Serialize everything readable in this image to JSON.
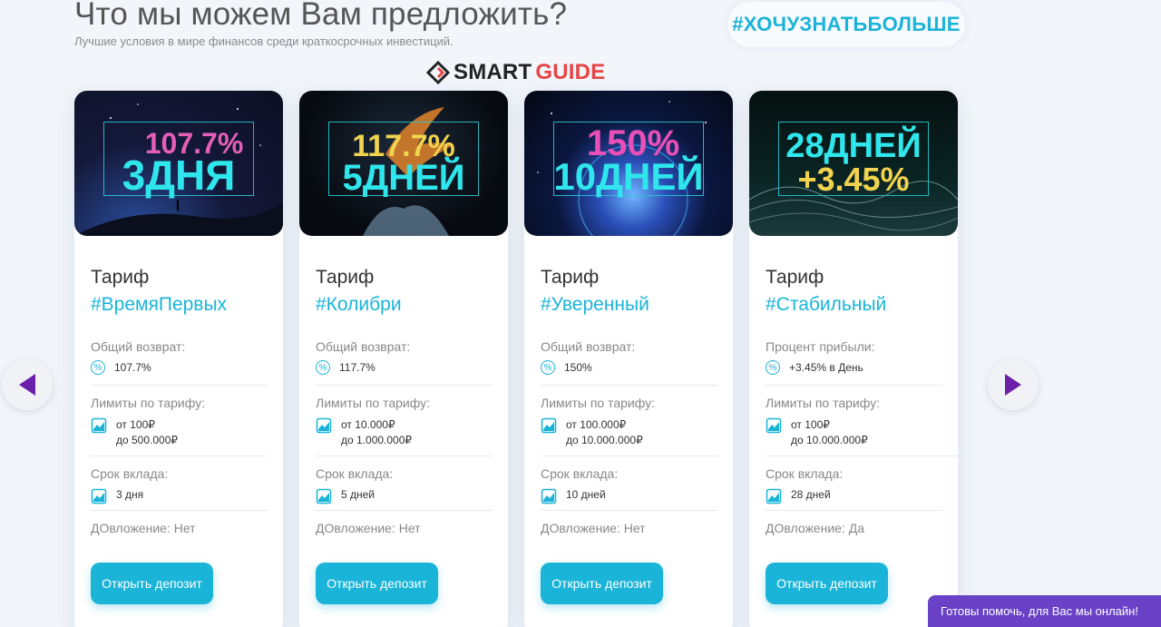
{
  "header": {
    "title": "Что мы можем Вам предложить?",
    "subtitle": "Лучшие условия в мире финансов среди краткосрочных инвестиций.",
    "tag": "#ХОЧУЗНАТЬБОЛЬШЕ"
  },
  "logo": {
    "part1": "SMART",
    "part2": "GUIDE"
  },
  "cards": [
    {
      "img_top": "107.7%",
      "img_bottom": "3ДНЯ",
      "label": "Тариф",
      "name": "#ВремяПервых",
      "return_title": "Общий возврат:",
      "return_value": "107.7%",
      "limits_title": "Лимиты по тарифу:",
      "limit_from": "от 100₽",
      "limit_to": "до 500.000₽",
      "term_title": "Срок вклада:",
      "term_value": "3 дня",
      "reinvest": "ДОвложение: Нет",
      "button": "Открыть депозит"
    },
    {
      "img_top": "117.7%",
      "img_bottom": "5ДНЕЙ",
      "label": "Тариф",
      "name": "#Колибри",
      "return_title": "Общий возврат:",
      "return_value": "117.7%",
      "limits_title": "Лимиты по тарифу:",
      "limit_from": "от 10.000₽",
      "limit_to": "до 1.000.000₽",
      "term_title": "Срок вклада:",
      "term_value": "5 дней",
      "reinvest": "ДОвложение: Нет",
      "button": "Открыть депозит"
    },
    {
      "img_top": "150%",
      "img_bottom": "10ДНЕЙ",
      "label": "Тариф",
      "name": "#Уверенный",
      "return_title": "Общий возврат:",
      "return_value": "150%",
      "limits_title": "Лимиты по тарифу:",
      "limit_from": "от 100.000₽",
      "limit_to": "до 10.000.000₽",
      "term_title": "Срок вклада:",
      "term_value": "10 дней",
      "reinvest": "ДОвложение: Нет",
      "button": "Открыть депозит"
    },
    {
      "img_top": "28ДНЕЙ",
      "img_bottom": "+3.45%",
      "label": "Тариф",
      "name": "#Стабильный",
      "return_title": "Процент прибыли:",
      "return_value": "+3.45% в День",
      "limits_title": "Лимиты по тарифу:",
      "limit_from": "от 100₽",
      "limit_to": "до 10.000.000₽",
      "term_title": "Срок вклада:",
      "term_value": "28 дней",
      "reinvest": "ДОвложение: Да",
      "button": "Открыть депозит"
    }
  ],
  "chat": {
    "label": "Готовы помочь, для Вас мы онлайн!"
  },
  "colors": {
    "accent": "#1ab4d8",
    "arrow": "#6b1fa8",
    "chat": "#6a42c8",
    "logo_red": "#e84545"
  }
}
